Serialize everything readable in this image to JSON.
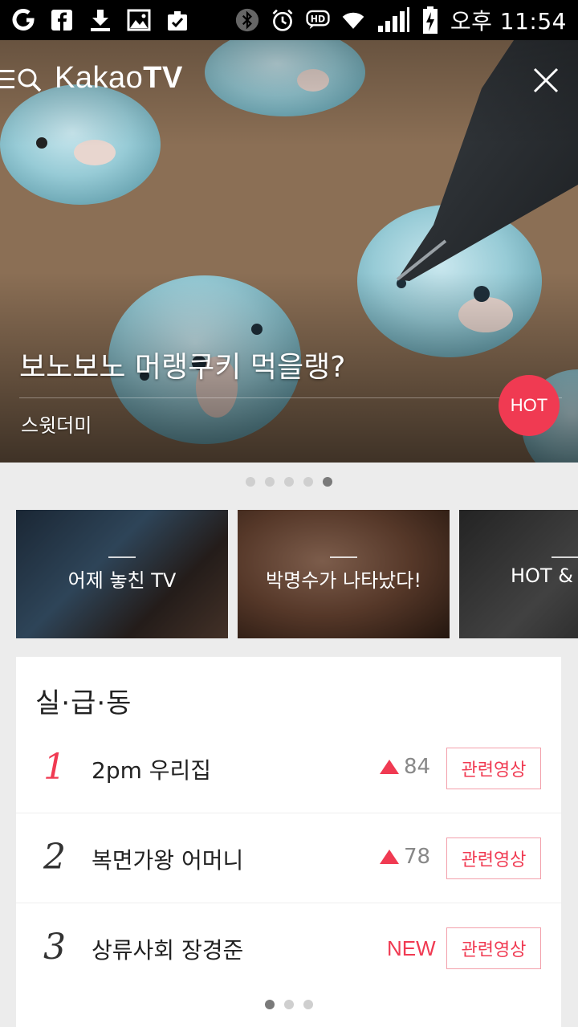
{
  "status_bar": {
    "time": "오후 11:54",
    "icons": [
      "o-app-icon",
      "facebook-icon",
      "download-icon",
      "gallery-icon",
      "clipboard-check-icon",
      "bluetooth-icon",
      "alarm-icon",
      "hd-icon",
      "wifi-icon",
      "signal-icon",
      "battery-icon"
    ]
  },
  "header": {
    "logo_light": "Kakao",
    "logo_bold": "TV"
  },
  "hero": {
    "title": "보노보노 머랭쿠키 먹을랭?",
    "channel": "스윗더미",
    "badge": "HOT",
    "pager_count": 5,
    "pager_active": 4
  },
  "categories": [
    {
      "label": "어제 놓친 TV"
    },
    {
      "label": "박명수가 나타났다!"
    },
    {
      "label": "HOT & NEW"
    }
  ],
  "ranking": {
    "title": "실·급·동",
    "related_label": "관련영상",
    "items": [
      {
        "rank": "1",
        "title": "2pm 우리집",
        "change": "84",
        "is_new": false
      },
      {
        "rank": "2",
        "title": "복면가왕 어머니",
        "change": "78",
        "is_new": false
      },
      {
        "rank": "3",
        "title": "상류사회 장경준",
        "change": "NEW",
        "is_new": true
      }
    ],
    "pager_count": 3,
    "pager_active": 0
  },
  "colors": {
    "accent": "#f03a52",
    "background": "#ececec"
  }
}
